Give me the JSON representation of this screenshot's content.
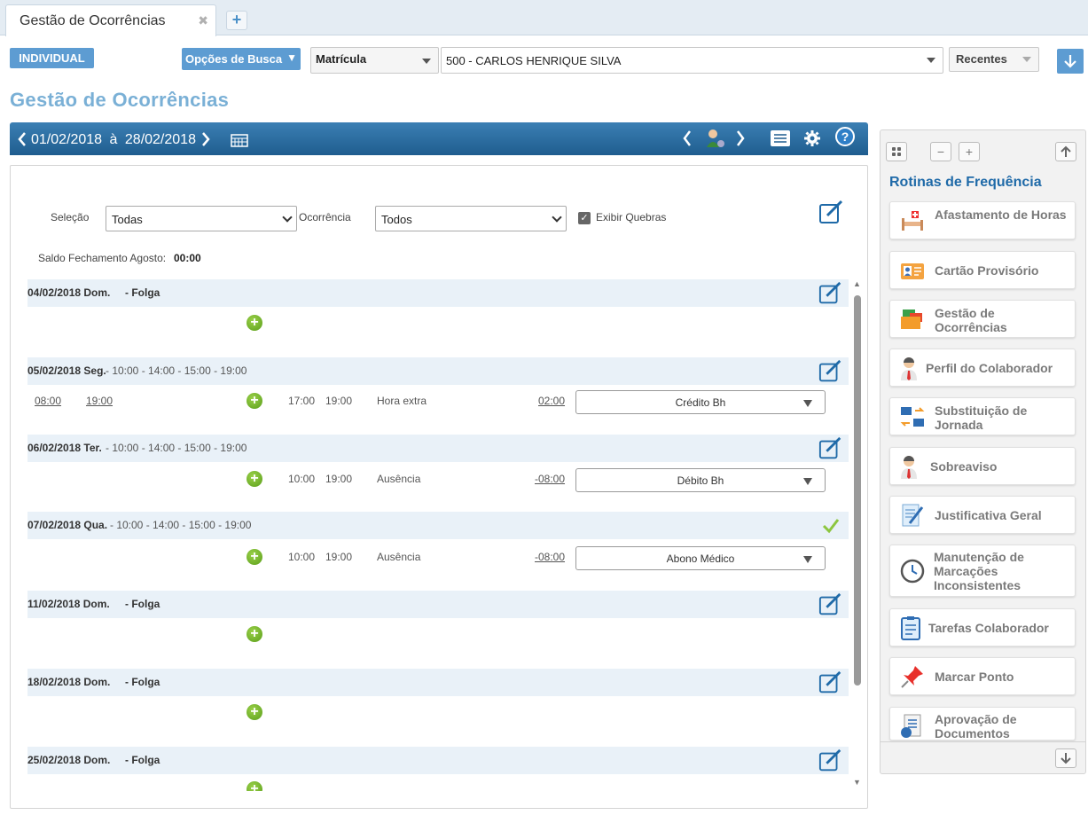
{
  "tabs": [
    {
      "label": "Gestão de Ocorrências"
    }
  ],
  "toolbar": {
    "mode": "INDIVIDUAL",
    "search_options": "Opções de Busca",
    "search_field": "Matrícula",
    "employee": "500 - CARLOS HENRIQUE SILVA",
    "recent": "Recentes"
  },
  "page_title": "Gestão de Ocorrências",
  "period": {
    "start": "01/02/2018",
    "sep": "à",
    "end": "28/02/2018"
  },
  "filters": {
    "selection_label": "Seleção",
    "selection_value": "Todas",
    "occurrence_label": "Ocorrência",
    "occurrence_value": "Todos",
    "show_breaks_label": "Exibir Quebras",
    "show_breaks_checked": true
  },
  "balance": {
    "label": "Saldo Fechamento Agosto:",
    "value": "00:00"
  },
  "days": [
    {
      "date": "04/02/2018 Dom.",
      "schedule": "",
      "folga": "- Folga"
    },
    {
      "date": "05/02/2018 Seg.",
      "schedule": "- 10:00 - 14:00 - 15:00 - 19:00",
      "folga": "",
      "entry": {
        "in": "08:00",
        "out": "19:00",
        "start": "17:00",
        "end": "19:00",
        "type": "Hora extra",
        "hours": "02:00",
        "action": "Crédito Bh"
      }
    },
    {
      "date": "06/02/2018 Ter.",
      "schedule": "- 10:00 - 14:00 - 15:00 - 19:00",
      "folga": "",
      "entry": {
        "start": "10:00",
        "end": "19:00",
        "type": "Ausência",
        "hours": "-08:00",
        "action": "Débito Bh"
      }
    },
    {
      "date": "07/02/2018 Qua.",
      "schedule": "- 10:00 - 14:00 - 15:00 - 19:00",
      "folga": "",
      "entry": {
        "start": "10:00",
        "end": "19:00",
        "type": "Ausência",
        "hours": "-08:00",
        "action": "Abono Médico"
      }
    },
    {
      "date": "11/02/2018 Dom.",
      "schedule": "",
      "folga": "- Folga"
    },
    {
      "date": "18/02/2018 Dom.",
      "schedule": "",
      "folga": "- Folga"
    },
    {
      "date": "25/02/2018 Dom.",
      "schedule": "",
      "folga": "- Folga"
    }
  ],
  "sidebar": {
    "title": "Rotinas de Frequência",
    "items": [
      {
        "label": "Afastamento de Horas",
        "icon": "hospital-bed-icon"
      },
      {
        "label": "Cartão Provisório",
        "icon": "id-card-icon"
      },
      {
        "label": "Gestão de Ocorrências",
        "icon": "folders-icon"
      },
      {
        "label": "Perfil do Colaborador",
        "icon": "person-icon"
      },
      {
        "label": "Substituição de Jornada",
        "icon": "swap-icon"
      },
      {
        "label": "Sobreaviso",
        "icon": "person-alert-icon"
      },
      {
        "label": "Justificativa Geral",
        "icon": "document-pen-icon"
      },
      {
        "label": "Manutenção de Marcações Inconsistentes",
        "icon": "clock-icon"
      },
      {
        "label": "Tarefas Colaborador",
        "icon": "clipboard-icon"
      },
      {
        "label": "Marcar Ponto",
        "icon": "pushpin-icon"
      },
      {
        "label": "Aprovação de Documentos",
        "icon": "document-approve-icon"
      }
    ]
  },
  "colors": {
    "accent": "#5d9cd2",
    "header_blue": "#1f5d8f",
    "title": "#7ab0d6",
    "row_bg": "#e9f1f8",
    "success": "#8cc63f"
  }
}
